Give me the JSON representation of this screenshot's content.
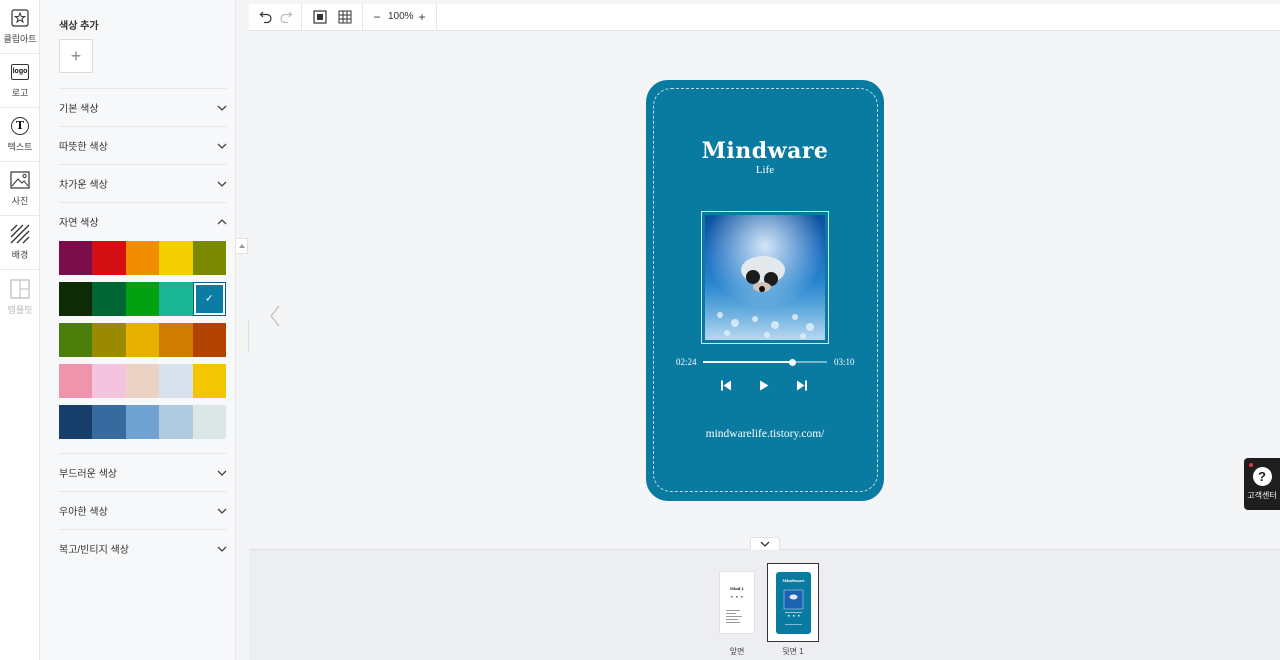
{
  "rail": {
    "items": [
      {
        "label": "클립아트",
        "icon": "clipart-star-icon"
      },
      {
        "label": "로고",
        "icon": "logo-icon",
        "icon_text": "logo"
      },
      {
        "label": "텍스트",
        "icon": "text-t-icon",
        "icon_text": "T"
      },
      {
        "label": "사진",
        "icon": "photo-icon"
      },
      {
        "label": "배경",
        "icon": "background-hatch-icon"
      },
      {
        "label": "템플릿",
        "icon": "template-icon",
        "disabled": true
      }
    ]
  },
  "panel": {
    "title": "색상 추가",
    "add_symbol": "+",
    "sections": [
      {
        "label": "기본 색상",
        "expanded": false
      },
      {
        "label": "따뜻한 색상",
        "expanded": false
      },
      {
        "label": "차가운 색상",
        "expanded": false
      },
      {
        "label": "자연 색상",
        "expanded": true
      },
      {
        "label": "부드러운 색상",
        "expanded": false
      },
      {
        "label": "우아한 색상",
        "expanded": false
      },
      {
        "label": "복고/빈티지 색상",
        "expanded": false
      }
    ],
    "nature_swatches": [
      [
        "#7b0d4b",
        "#d30f14",
        "#f28c00",
        "#f3cf00",
        "#7a8a00"
      ],
      [
        "#0f2b06",
        "#006634",
        "#01a112",
        "#18b694",
        "#0b7ca3"
      ],
      [
        "#4b7e0b",
        "#9a8a00",
        "#e8b100",
        "#d07c00",
        "#b24202"
      ],
      [
        "#ee95ad",
        "#f4c3dd",
        "#ecd2c5",
        "#d8e2ec",
        "#f2c600"
      ],
      [
        "#173e6b",
        "#376ba0",
        "#70a3d1",
        "#aecbe0",
        "#dbe6e6"
      ]
    ],
    "selected_color": "#0b7ca3"
  },
  "toolbar": {
    "zoom": "100%",
    "zoom_out": "−",
    "zoom_in": "+"
  },
  "card": {
    "background": "#097aa0",
    "title": "Mindware",
    "subtitle": "Life",
    "time_elapsed": "02:24",
    "time_total": "03:10",
    "progress": 0.72,
    "url": "mindwarelife.tistory.com/"
  },
  "help": {
    "label": "고객센터",
    "symbol": "?"
  },
  "pages": [
    {
      "label": "앞면",
      "thumb_title": "Mind L"
    },
    {
      "label": "뒷면 1",
      "thumb_title": "Mindware",
      "selected": true
    }
  ]
}
